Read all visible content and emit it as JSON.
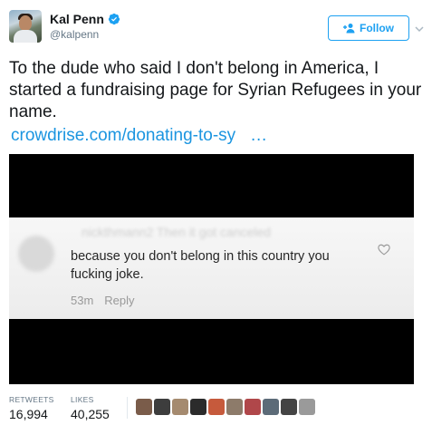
{
  "header": {
    "display_name": "Kal Penn",
    "handle": "@kalpenn",
    "follow_label": "Follow",
    "verified_icon": "verified-badge-icon"
  },
  "tweet": {
    "text": "To the dude who said I don't belong in America, I started a fundraising page for Syrian Refugees in your name.",
    "link_text": "crowdrise.com/donating-to-sy",
    "link_ellipsis": "…"
  },
  "media": {
    "blurred_username": "nickthmann2 Then it got canceled",
    "comment_text": "because you don't belong in this country you fucking joke.",
    "time": "53m",
    "reply_label": "Reply"
  },
  "stats": {
    "retweets_label": "RETWEETS",
    "retweets_count": "16,994",
    "likes_label": "LIKES",
    "likes_count": "40,255"
  },
  "colors": {
    "accent": "#1da1f2",
    "link": "#1b95e0",
    "text": "#14171a",
    "muted": "#657786"
  },
  "likers": [
    {
      "color": "#7a5c4a"
    },
    {
      "color": "#3d3d3d"
    },
    {
      "color": "#a58a6f"
    },
    {
      "color": "#2b2b2b"
    },
    {
      "color": "#c65a3c"
    },
    {
      "color": "#8d7b6a"
    },
    {
      "color": "#b0474a"
    },
    {
      "color": "#5c6b78"
    },
    {
      "color": "#444444"
    },
    {
      "color": "#9a9a9a"
    }
  ]
}
